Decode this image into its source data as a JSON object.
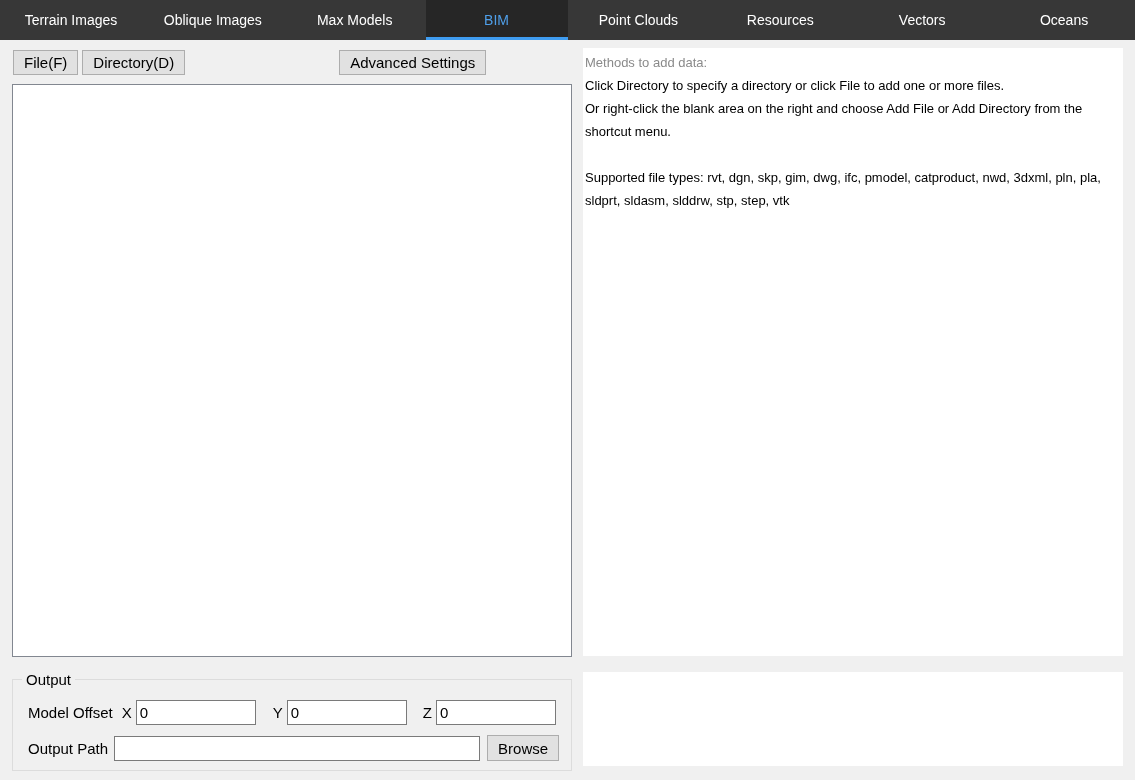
{
  "tabs": [
    {
      "label": "Terrain Images",
      "selected": false
    },
    {
      "label": "Oblique Images",
      "selected": false
    },
    {
      "label": "Max Models",
      "selected": false
    },
    {
      "label": "BIM",
      "selected": true
    },
    {
      "label": "Point Clouds",
      "selected": false
    },
    {
      "label": "Resources",
      "selected": false
    },
    {
      "label": "Vectors",
      "selected": false
    },
    {
      "label": "Oceans",
      "selected": false
    }
  ],
  "toolbar": {
    "left_buttons": [
      "File(F)",
      "Directory(D)"
    ],
    "settings_button": "Advanced Settings"
  },
  "help": {
    "title": "Methods to add data:",
    "blocks": [
      [
        "Click Directory to specify a directory or click File to add one or more files.",
        "Or right-click the blank area on the right and choose Add File or Add Directory from the shortcut menu."
      ],
      [
        "Supported file types: rvt, dgn, skp, gim, dwg, ifc, pmodel, catproduct, nwd, 3dxml, pln, pla, sldprt, sldasm, slddrw, stp, step, vtk"
      ]
    ]
  },
  "output": {
    "title": "Output",
    "offset_label": "Model Offset",
    "offsets": [
      {
        "axis": "X",
        "value": "0"
      },
      {
        "axis": "Y",
        "value": "0"
      },
      {
        "axis": "Z",
        "value": "0"
      }
    ],
    "path_label": "Output Path",
    "browse_button": "Browse"
  }
}
